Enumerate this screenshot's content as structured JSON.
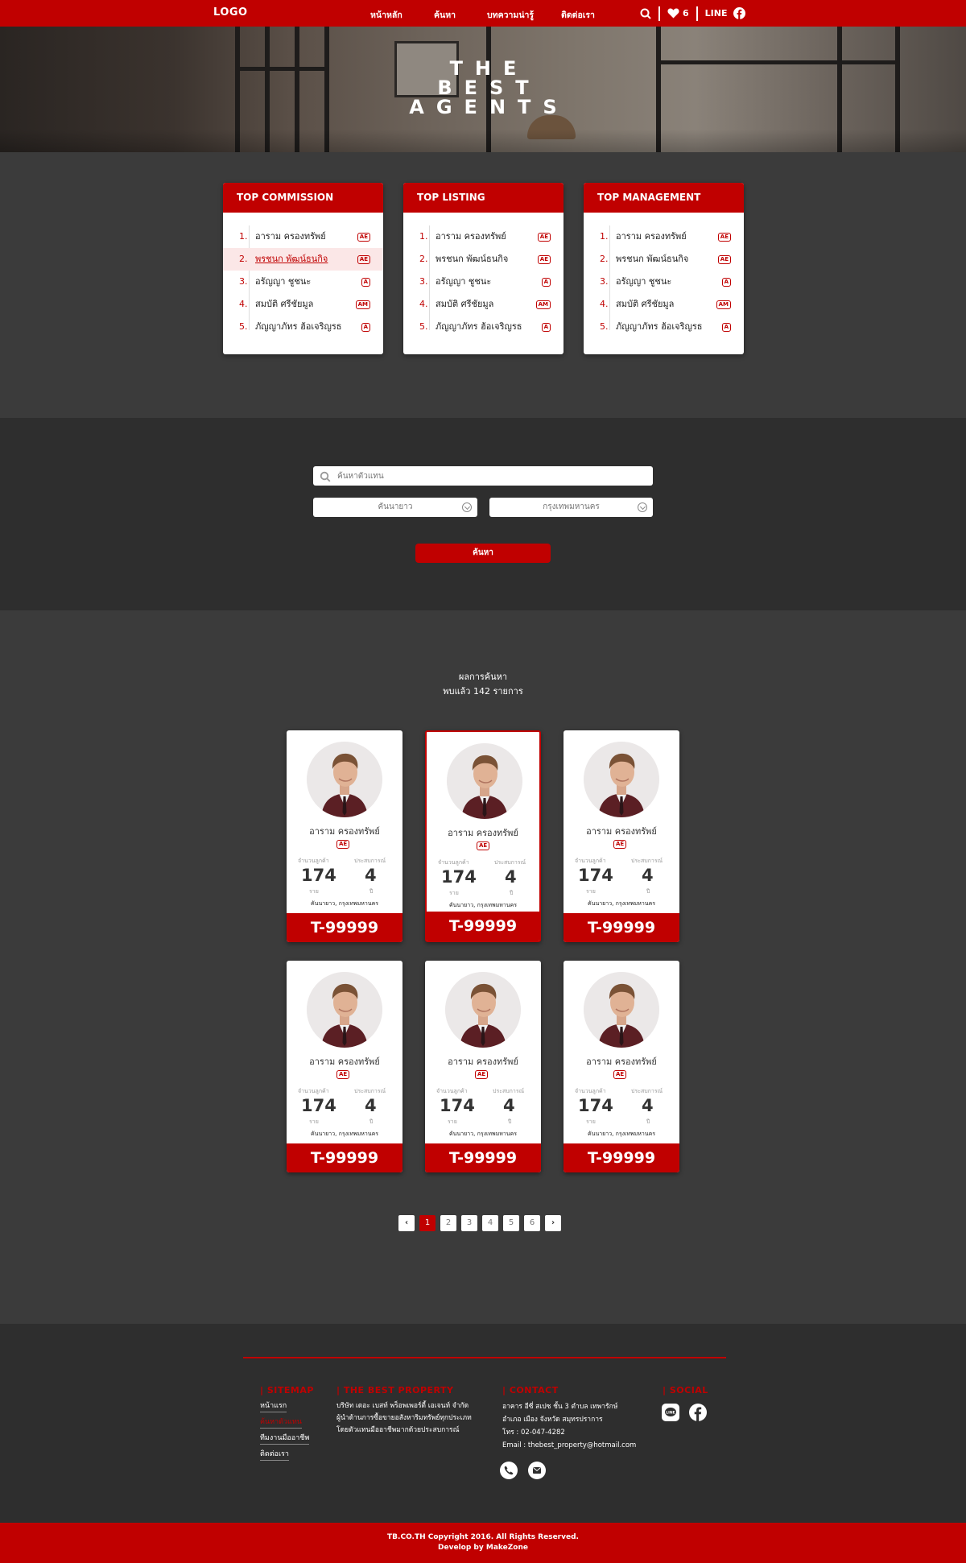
{
  "nav": {
    "logo": "LOGO",
    "links": [
      "หน้าหลัก",
      "ค้นหา",
      "บทความน่ารู้",
      "ติดต่อเรา"
    ],
    "favorites_count": "6",
    "line_label": "LINE"
  },
  "hero": {
    "title_lines": [
      "THE",
      "BEST",
      "AGENTS"
    ]
  },
  "rankings": [
    {
      "title": "TOP COMMISSION",
      "items": [
        {
          "num": "1.",
          "name": "อาราม ครองทรัพย์",
          "badge": "AE"
        },
        {
          "num": "2.",
          "name": "พรชนก พัฒน์ธนกิจ",
          "badge": "AE"
        },
        {
          "num": "3.",
          "name": "อรัญญา ชูชนะ",
          "badge": "A"
        },
        {
          "num": "4.",
          "name": "สมบัติ ศรีชัยมูล",
          "badge": "AM"
        },
        {
          "num": "5.",
          "name": "ภัญญาภัทร ฮ้อเจริญรธ",
          "badge": "A"
        }
      ]
    },
    {
      "title": "TOP LISTING",
      "items": [
        {
          "num": "1.",
          "name": "อาราม ครองทรัพย์",
          "badge": "AE"
        },
        {
          "num": "2.",
          "name": "พรชนก พัฒน์ธนกิจ",
          "badge": "AE"
        },
        {
          "num": "3.",
          "name": "อรัญญา ชูชนะ",
          "badge": "A"
        },
        {
          "num": "4.",
          "name": "สมบัติ ศรีชัยมูล",
          "badge": "AM"
        },
        {
          "num": "5.",
          "name": "ภัญญาภัทร ฮ้อเจริญรธ",
          "badge": "A"
        }
      ]
    },
    {
      "title": "TOP MANAGEMENT",
      "items": [
        {
          "num": "1.",
          "name": "อาราม ครองทรัพย์",
          "badge": "AE"
        },
        {
          "num": "2.",
          "name": "พรชนก พัฒน์ธนกิจ",
          "badge": "AE"
        },
        {
          "num": "3.",
          "name": "อรัญญา ชูชนะ",
          "badge": "A"
        },
        {
          "num": "4.",
          "name": "สมบัติ ศรีชัยมูล",
          "badge": "AM"
        },
        {
          "num": "5.",
          "name": "ภัญญาภัทร ฮ้อเจริญรธ",
          "badge": "A"
        }
      ]
    }
  ],
  "search": {
    "placeholder": "ค้นหาตัวแทน",
    "district": "คันนายาว",
    "province": "กรุงเทพมหานคร",
    "button": "ค้นหา"
  },
  "results": {
    "title": "ผลการค้นหา",
    "count": "พบแล้ว 142 รายการ",
    "agents": [
      {
        "name": "อาราม ครองทรัพย์",
        "badge": "AE",
        "customers_label": "จำนวนลูกค้า",
        "customers": "174",
        "customers_unit": "ราย",
        "exp_label": "ประสบการณ์",
        "exp": "4",
        "exp_unit": "ปี",
        "area": "คันนายาว, กรุงเทพมหานคร",
        "code": "T-99999"
      },
      {
        "name": "อาราม ครองทรัพย์",
        "badge": "AE",
        "customers_label": "จำนวนลูกค้า",
        "customers": "174",
        "customers_unit": "ราย",
        "exp_label": "ประสบการณ์",
        "exp": "4",
        "exp_unit": "ปี",
        "area": "คันนายาว, กรุงเทพมหานคร",
        "code": "T-99999"
      },
      {
        "name": "อาราม ครองทรัพย์",
        "badge": "AE",
        "customers_label": "จำนวนลูกค้า",
        "customers": "174",
        "customers_unit": "ราย",
        "exp_label": "ประสบการณ์",
        "exp": "4",
        "exp_unit": "ปี",
        "area": "คันนายาว, กรุงเทพมหานคร",
        "code": "T-99999"
      },
      {
        "name": "อาราม ครองทรัพย์",
        "badge": "AE",
        "customers_label": "จำนวนลูกค้า",
        "customers": "174",
        "customers_unit": "ราย",
        "exp_label": "ประสบการณ์",
        "exp": "4",
        "exp_unit": "ปี",
        "area": "คันนายาว, กรุงเทพมหานคร",
        "code": "T-99999"
      },
      {
        "name": "อาราม ครองทรัพย์",
        "badge": "AE",
        "customers_label": "จำนวนลูกค้า",
        "customers": "174",
        "customers_unit": "ราย",
        "exp_label": "ประสบการณ์",
        "exp": "4",
        "exp_unit": "ปี",
        "area": "คันนายาว, กรุงเทพมหานคร",
        "code": "T-99999"
      },
      {
        "name": "อาราม ครองทรัพย์",
        "badge": "AE",
        "customers_label": "จำนวนลูกค้า",
        "customers": "174",
        "customers_unit": "ราย",
        "exp_label": "ประสบการณ์",
        "exp": "4",
        "exp_unit": "ปี",
        "area": "คันนายาว, กรุงเทพมหานคร",
        "code": "T-99999"
      }
    ]
  },
  "pagination": {
    "prev": "‹",
    "pages": [
      "1",
      "2",
      "3",
      "4",
      "5",
      "6"
    ],
    "next": "›",
    "current": "1"
  },
  "footer": {
    "sitemap_title": "| SITEMAP",
    "sitemap_items": [
      "หน้าแรก",
      "ค้นหาตัวแทน",
      "ทีมงานมืออาชีพ",
      "ติดต่อเรา"
    ],
    "company_title": "| THE BEST PROPERTY",
    "company_lines": [
      "บริษัท เดอะ เบสท์ พร็อพเพอร์ตี้ เอเจนท์ จำกัด",
      "ผู้นำด้านการซื้อขายอสังหาริมทรัพย์ทุกประเภท",
      "โดยตัวแทนมืออาชีพมากด้วยประสบการณ์"
    ],
    "contact_title": "| CONTACT",
    "contact_lines": [
      "อาคาร อีซี่ สเปซ ชั้น 3 ตำบล เทพารักษ์",
      "อำเภอ เมือง จังหวัด สมุทรปราการ",
      "โทร : 02-047-4282",
      "Email : thebest_property@hotmail.com"
    ],
    "social_title": "| SOCIAL",
    "copyright": "TB.CO.TH  Copyright 2016. All Rights Reserved.",
    "developer": "Develop by MakeZone"
  },
  "colors": {
    "brand_red": "#c00000",
    "dark_bg": "#3b3b3b",
    "darker_bg": "#2e2e2e"
  },
  "icons": [
    "search-icon",
    "heart-icon",
    "facebook-icon",
    "line-icon",
    "phone-icon",
    "mail-icon",
    "chevron-down-icon"
  ]
}
